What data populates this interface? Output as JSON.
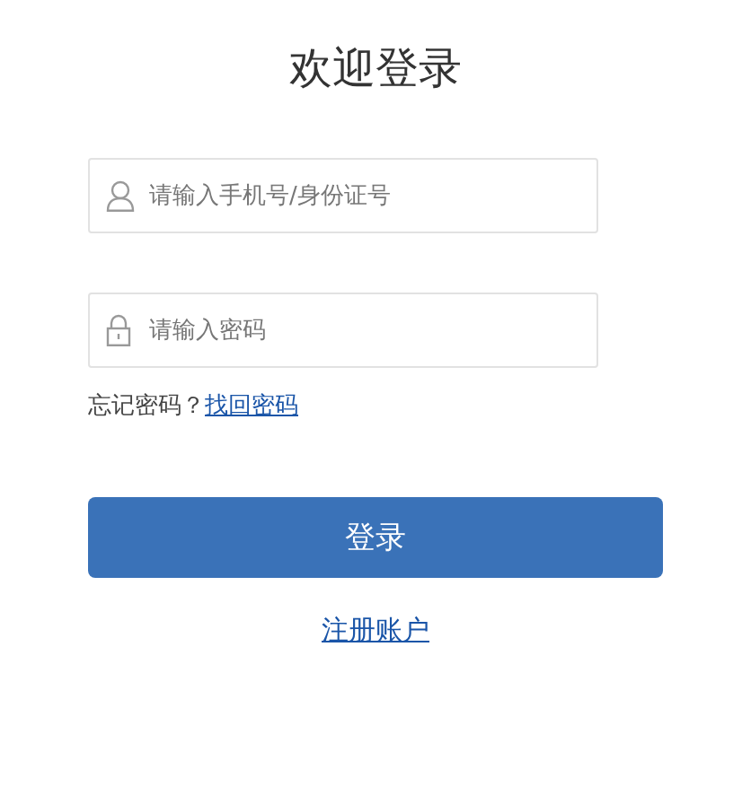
{
  "title": "欢迎登录",
  "fields": [
    {
      "kind": "user",
      "placeholder": "请输入手机号/身份证号"
    },
    {
      "kind": "lock",
      "placeholder": "请输入密码"
    }
  ],
  "forgot": {
    "text": "忘记密码？",
    "link": "找回密码"
  },
  "login_button": "登录",
  "register_link": "注册账户"
}
